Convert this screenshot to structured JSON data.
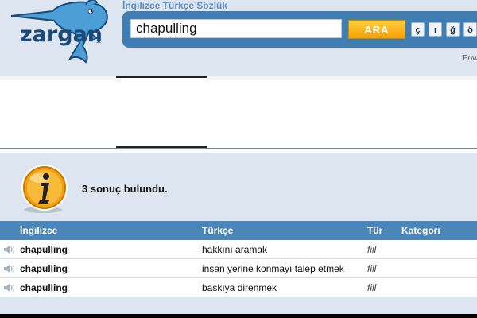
{
  "header": {
    "logo_text": "zargan",
    "site_title": "İngilizce Türkçe Sözlük",
    "search": {
      "value": "chapulling",
      "button_label": "ARA"
    },
    "special_chars": [
      "ç",
      "ı",
      "ğ",
      "ö"
    ],
    "powered_text": "Pow"
  },
  "results": {
    "summary": "3 sonuç bulundu.",
    "columns": {
      "english": "İngilizce",
      "turkish": "Türkçe",
      "type": "Tür",
      "category": "Kategori"
    },
    "rows": [
      {
        "english": "chapulling",
        "turkish": "hakkını aramak",
        "type": "fiil",
        "category": ""
      },
      {
        "english": "chapulling",
        "turkish": "insan yerine konmayı talep etmek",
        "type": "fiil",
        "category": ""
      },
      {
        "english": "chapulling",
        "turkish": "baskıya direnmek",
        "type": "fiil",
        "category": ""
      }
    ]
  },
  "colors": {
    "page_bg": "#dde6f0",
    "search_bar": "#3f7db3",
    "search_button": "#f5a000",
    "table_header": "#4a86b8",
    "logo_text": "#1b4a7a"
  },
  "icons": [
    "dolphin-logo",
    "info-icon",
    "speaker-icon"
  ]
}
